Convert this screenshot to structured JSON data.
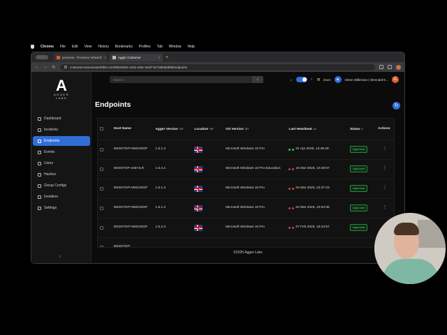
{
  "macos_menu": [
    "Chrome",
    "File",
    "Edit",
    "View",
    "History",
    "Bookmarks",
    "Profiles",
    "Tab",
    "Window",
    "Help"
  ],
  "browser": {
    "tabs": [
      {
        "label": "proxmox - Proxmox Virtual E",
        "active": false
      },
      {
        "label": "Agger Customer",
        "active": true
      }
    ],
    "url": "customer.ransomwarekiller.com/9051b09c-4c81-40ec-9ed7-fa719ba93bfd/endpoints"
  },
  "app": {
    "logo_text": "AGGER",
    "logo_sub": "LABS",
    "search_placeholder": "Search...",
    "docs_label": "Docs",
    "user_label": "Glenn Wilkinson | Glenndaf E...",
    "avatar_initial": "G",
    "nav": [
      {
        "label": "Dashboard",
        "icon": "dashboard-icon",
        "active": false
      },
      {
        "label": "Incidents",
        "icon": "incidents-icon",
        "active": false
      },
      {
        "label": "Endpoints",
        "icon": "endpoints-icon",
        "active": true
      },
      {
        "label": "Events",
        "icon": "events-icon",
        "active": false
      },
      {
        "label": "Users",
        "icon": "users-icon",
        "active": false
      },
      {
        "label": "Hashes",
        "icon": "hashes-icon",
        "active": false
      },
      {
        "label": "Group Configs",
        "icon": "group-configs-icon",
        "active": false
      },
      {
        "label": "Installers",
        "icon": "installers-icon",
        "active": false
      },
      {
        "label": "Settings",
        "icon": "settings-icon",
        "active": false
      }
    ],
    "page_title": "Endpoints",
    "footer": "©2025 Agger Labs"
  },
  "table": {
    "columns": [
      "Host Name",
      "Agger Version",
      "Location",
      "OS Version",
      "Last Heartbeat",
      "Status",
      "Actions"
    ],
    "rows": [
      {
        "host": "DESKTOP-NMCD0GP",
        "version": "1.5.1.2",
        "os": "Microsoft Windows 10 Pro",
        "heartbeat": "01 Apr 2025, 13:48:48",
        "status": "Approved"
      },
      {
        "host": "DESKTOP-446YILR",
        "version": "1.5.4.1",
        "os": "Microsoft Windows 10 Pro Education",
        "heartbeat": "24 Mar 2025, 10:29:57",
        "status": "Approved"
      },
      {
        "host": "DESKTOP-NMCD0GP",
        "version": "1.5.1.2",
        "os": "Microsoft Windows 10 Pro",
        "heartbeat": "04 Mar 2025, 22:47:23",
        "status": "Approved"
      },
      {
        "host": "DESKTOP-NMCD0GP",
        "version": "1.5.1.2",
        "os": "Microsoft Windows 10 Pro",
        "heartbeat": "04 Mar 2025, 10:23:36",
        "status": "Approved"
      },
      {
        "host": "DESKTOP-NMCD0GP",
        "version": "1.5.2.3",
        "os": "Microsoft Windows 10 Pro",
        "heartbeat": "07 Feb 2025, 16:24:57",
        "status": "Approved"
      },
      {
        "host": "DESKTOP-",
        "version": "",
        "os": "",
        "heartbeat": "",
        "status": ""
      }
    ]
  },
  "colors": {
    "accent": "#2f6fd6",
    "approved": "#4cd26b",
    "heartbeat_red": "#d83b3b",
    "heartbeat_green": "#3fbf5a"
  }
}
